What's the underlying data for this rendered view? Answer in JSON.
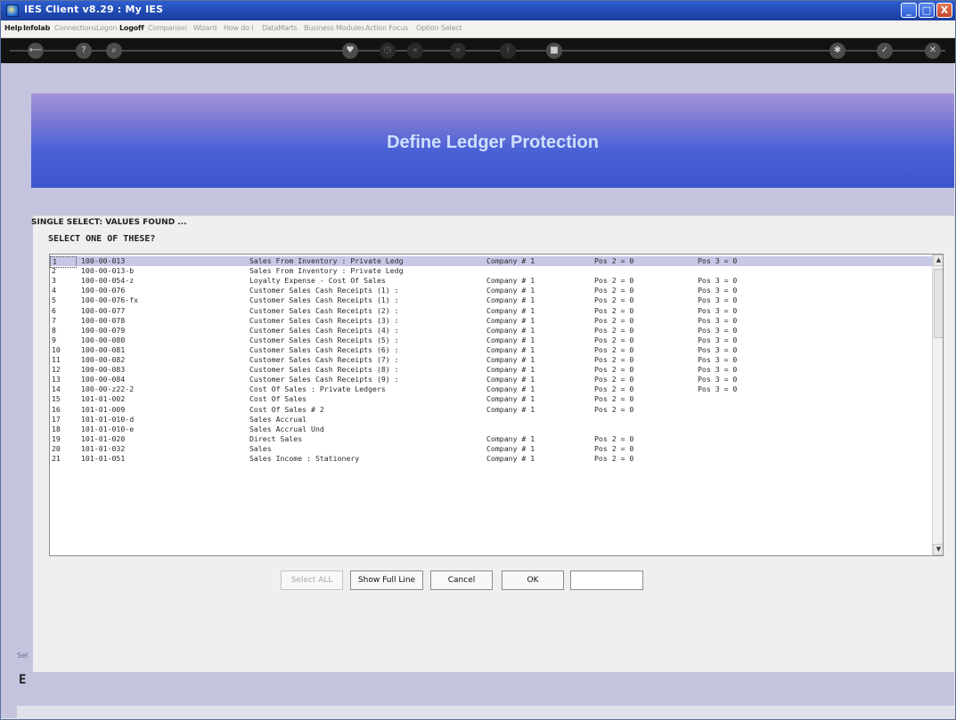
{
  "window": {
    "title": "IES Client v8.29 : My IES",
    "minimize": "_",
    "maximize": "□",
    "close": "X"
  },
  "menu": {
    "items": [
      "Help",
      "Infolab",
      "Connections",
      "Logon",
      "Logoff",
      "Companion",
      "Wizard",
      "How do I",
      "DataMarts",
      "Business Modules",
      "Action Focus",
      "Option Select"
    ]
  },
  "toolbar": {
    "icons": [
      "back-arrow-icon",
      "help-icon",
      "search-icon",
      "heart-icon",
      "clock-icon",
      "rewind-icon",
      "forward-icon",
      "info-icon",
      "stop-icon",
      "settings-icon",
      "check-icon",
      "close-icon"
    ]
  },
  "page": {
    "title": "Define Ledger Protection"
  },
  "dialog": {
    "title": "SINGLE SELECT: VALUES FOUND ...",
    "heading": "SELECT ONE OF THESE?",
    "rows": [
      {
        "num": "1",
        "code": "100-00-013",
        "desc": "Sales From Inventory : Private Ledg",
        "company": "Company # 1",
        "pos2": "Pos 2 = 0",
        "pos3": "Pos 3 = 0"
      },
      {
        "num": "2",
        "code": "100-00-013-b",
        "desc": "Sales From Inventory : Private Ledg",
        "company": "",
        "pos2": "",
        "pos3": ""
      },
      {
        "num": "3",
        "code": "100-00-054-z",
        "desc": "Loyalty Expense - Cost Of Sales",
        "company": "Company # 1",
        "pos2": "Pos 2 = 0",
        "pos3": "Pos 3 = 0"
      },
      {
        "num": "4",
        "code": "100-00-076",
        "desc": "Customer Sales Cash Receipts (1) :",
        "company": "Company # 1",
        "pos2": "Pos 2 = 0",
        "pos3": "Pos 3 = 0"
      },
      {
        "num": "5",
        "code": "100-00-076-fx",
        "desc": "Customer Sales Cash Receipts (1) :",
        "company": "Company # 1",
        "pos2": "Pos 2 = 0",
        "pos3": "Pos 3 = 0"
      },
      {
        "num": "6",
        "code": "100-00-077",
        "desc": "Customer Sales Cash Receipts (2) :",
        "company": "Company # 1",
        "pos2": "Pos 2 = 0",
        "pos3": "Pos 3 = 0"
      },
      {
        "num": "7",
        "code": "100-00-078",
        "desc": "Customer Sales Cash Receipts (3) :",
        "company": "Company # 1",
        "pos2": "Pos 2 = 0",
        "pos3": "Pos 3 = 0"
      },
      {
        "num": "8",
        "code": "100-00-079",
        "desc": "Customer Sales Cash Receipts (4) :",
        "company": "Company # 1",
        "pos2": "Pos 2 = 0",
        "pos3": "Pos 3 = 0"
      },
      {
        "num": "9",
        "code": "100-00-080",
        "desc": "Customer Sales Cash Receipts (5) :",
        "company": "Company # 1",
        "pos2": "Pos 2 = 0",
        "pos3": "Pos 3 = 0"
      },
      {
        "num": "10",
        "code": "100-00-081",
        "desc": "Customer Sales Cash Receipts (6) :",
        "company": "Company # 1",
        "pos2": "Pos 2 = 0",
        "pos3": "Pos 3 = 0"
      },
      {
        "num": "11",
        "code": "100-00-082",
        "desc": "Customer Sales Cash Receipts (7) :",
        "company": "Company # 1",
        "pos2": "Pos 2 = 0",
        "pos3": "Pos 3 = 0"
      },
      {
        "num": "12",
        "code": "100-00-083",
        "desc": "Customer Sales Cash Receipts (8) :",
        "company": "Company # 1",
        "pos2": "Pos 2 = 0",
        "pos3": "Pos 3 = 0"
      },
      {
        "num": "13",
        "code": "100-00-084",
        "desc": "Customer Sales Cash Receipts (9) :",
        "company": "Company # 1",
        "pos2": "Pos 2 = 0",
        "pos3": "Pos 3 = 0"
      },
      {
        "num": "14",
        "code": "100-00-z22-2",
        "desc": "Cost Of Sales : Private Ledgers",
        "company": "Company # 1",
        "pos2": "Pos 2 = 0",
        "pos3": "Pos 3 = 0"
      },
      {
        "num": "15",
        "code": "101-01-002",
        "desc": "Cost Of Sales",
        "company": "Company # 1",
        "pos2": "Pos 2 = 0",
        "pos3": ""
      },
      {
        "num": "16",
        "code": "101-01-009",
        "desc": "Cost Of Sales # 2",
        "company": "Company # 1",
        "pos2": "Pos 2 = 0",
        "pos3": ""
      },
      {
        "num": "17",
        "code": "101-01-010-d",
        "desc": "Sales Accrual",
        "company": "",
        "pos2": "",
        "pos3": ""
      },
      {
        "num": "18",
        "code": "101-01-010-e",
        "desc": "Sales Accrual Und",
        "company": "",
        "pos2": "",
        "pos3": ""
      },
      {
        "num": "19",
        "code": "101-01-020",
        "desc": "Direct Sales",
        "company": "Company # 1",
        "pos2": "Pos 2 = 0",
        "pos3": ""
      },
      {
        "num": "20",
        "code": "101-01-032",
        "desc": "Sales",
        "company": "Company # 1",
        "pos2": "Pos 2 = 0",
        "pos3": ""
      },
      {
        "num": "21",
        "code": "101-01-051",
        "desc": "Sales Income : Stationery",
        "company": "Company # 1",
        "pos2": "Pos 2 = 0",
        "pos3": ""
      }
    ],
    "buttons": {
      "select_all": "Select ALL",
      "show_full_line": "Show Full Line",
      "cancel": "Cancel",
      "ok": "OK"
    },
    "filter_value": ""
  },
  "footer": {
    "section_label": "Sel",
    "section_initial": "E"
  }
}
